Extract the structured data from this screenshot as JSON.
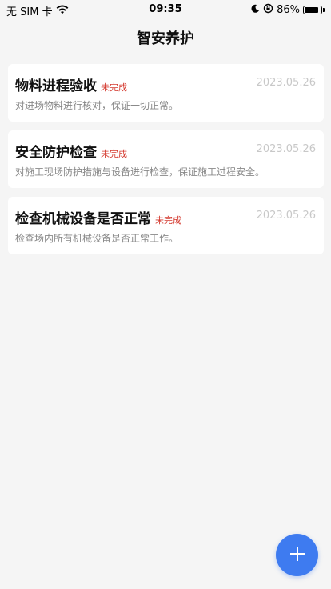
{
  "status_bar": {
    "carrier": "无 SIM 卡",
    "time": "09:35",
    "battery": "86%",
    "battery_level": 0.86
  },
  "header": {
    "title": "智安养护"
  },
  "tasks": [
    {
      "title": "物料进程验收",
      "status": "未完成",
      "date": "2023.05.26",
      "description": "对进场物料进行核对，保证一切正常。"
    },
    {
      "title": "安全防护检查",
      "status": "未完成",
      "date": "2023.05.26",
      "description": "对施工现场防护措施与设备进行检查，保证施工过程安全。"
    },
    {
      "title": "检查机械设备是否正常",
      "status": "未完成",
      "date": "2023.05.26",
      "description": "检查场内所有机械设备是否正常工作。"
    }
  ],
  "colors": {
    "accent": "#3e7bf0",
    "status_incomplete": "#d43a2f"
  }
}
